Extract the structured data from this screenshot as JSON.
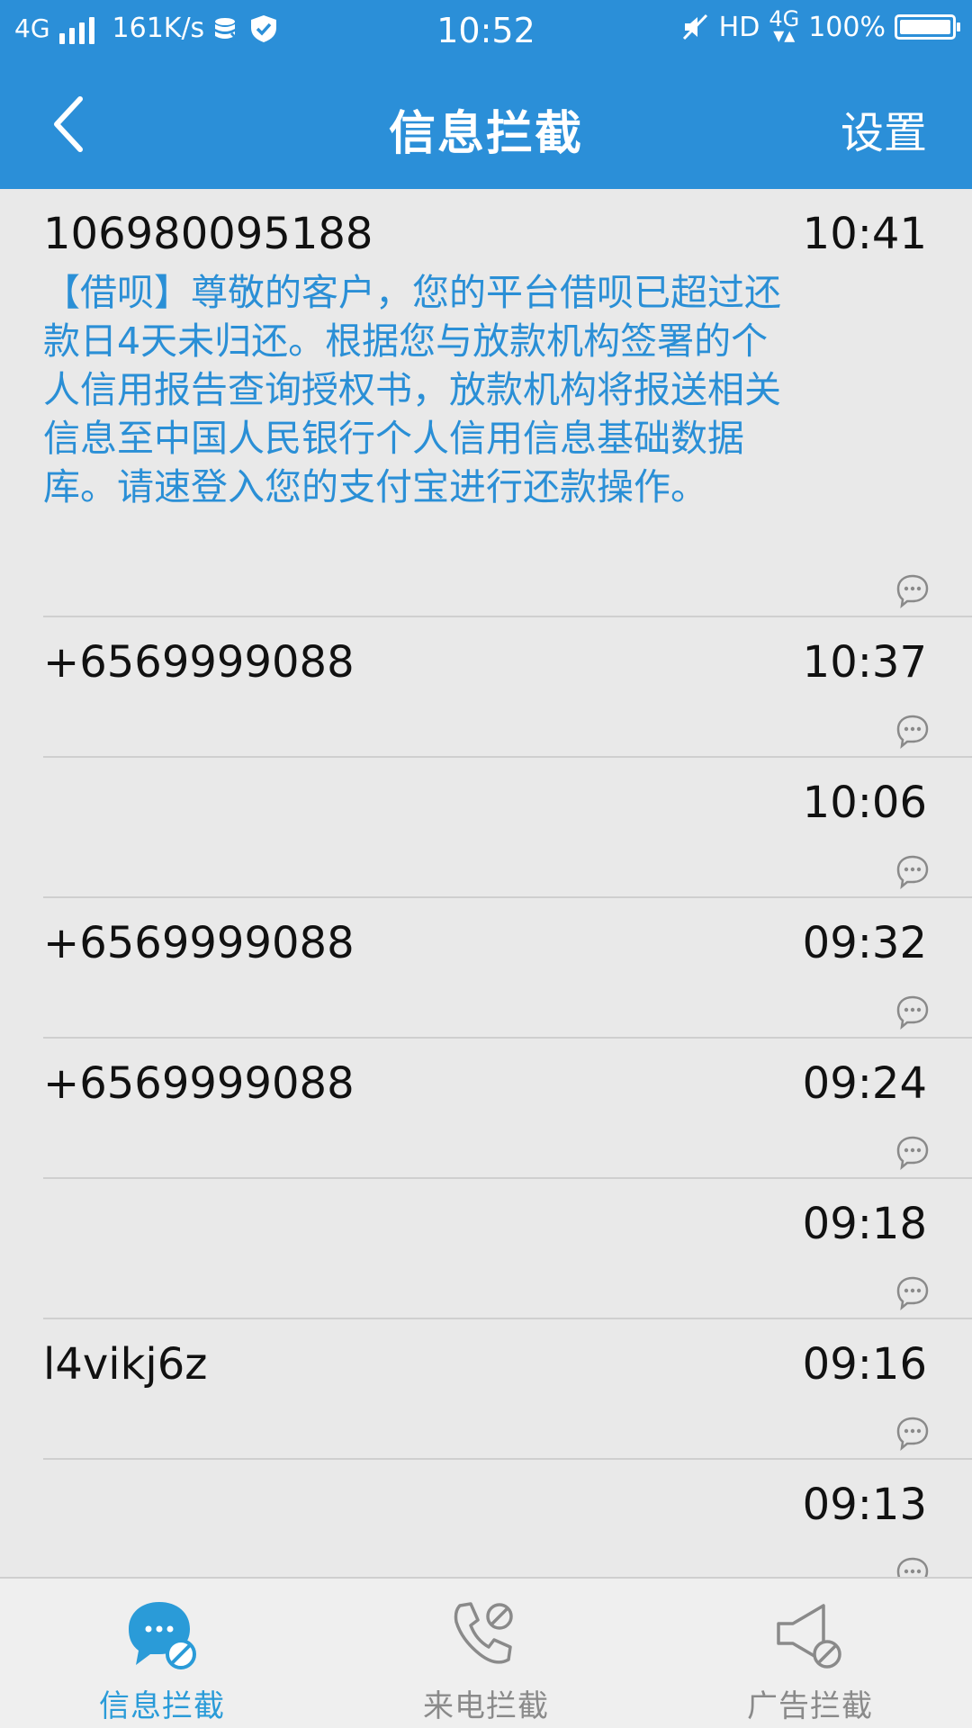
{
  "status_bar": {
    "network": "4G",
    "speed": "161K/s",
    "time": "10:52",
    "hd": "HD",
    "net_4g": "4G",
    "battery": "100%",
    "battery_level": 1.0
  },
  "header": {
    "title": "信息拦截",
    "settings_label": "设置"
  },
  "messages": [
    {
      "sender": "106980095188",
      "time": "10:41",
      "body": "【借呗】尊敬的客户，您的平台借呗已超过还款日4天未归还。根据您与放款机构签署的个人信用报告查询授权书，放款机构将报送相关信息至中国人民银行个人信用信息基础数据库。请速登入您的支付宝进行还款操作。"
    },
    {
      "sender": "+6569999088",
      "time": "10:37"
    },
    {
      "sender": "",
      "time": "10:06"
    },
    {
      "sender": "+6569999088",
      "time": "09:32"
    },
    {
      "sender": "+6569999088",
      "time": "09:24"
    },
    {
      "sender": "",
      "time": "09:18"
    },
    {
      "sender": "l4vikj6z",
      "time": "09:16"
    },
    {
      "sender": "",
      "time": "09:13"
    }
  ],
  "bottom_nav": {
    "sms_label": "信息拦截",
    "call_label": "来电拦截",
    "ad_label": "广告拦截"
  },
  "colors": {
    "accent": "#2b8fd8",
    "message_text": "#2a8fd6",
    "active_tab": "#2a9bd8"
  }
}
